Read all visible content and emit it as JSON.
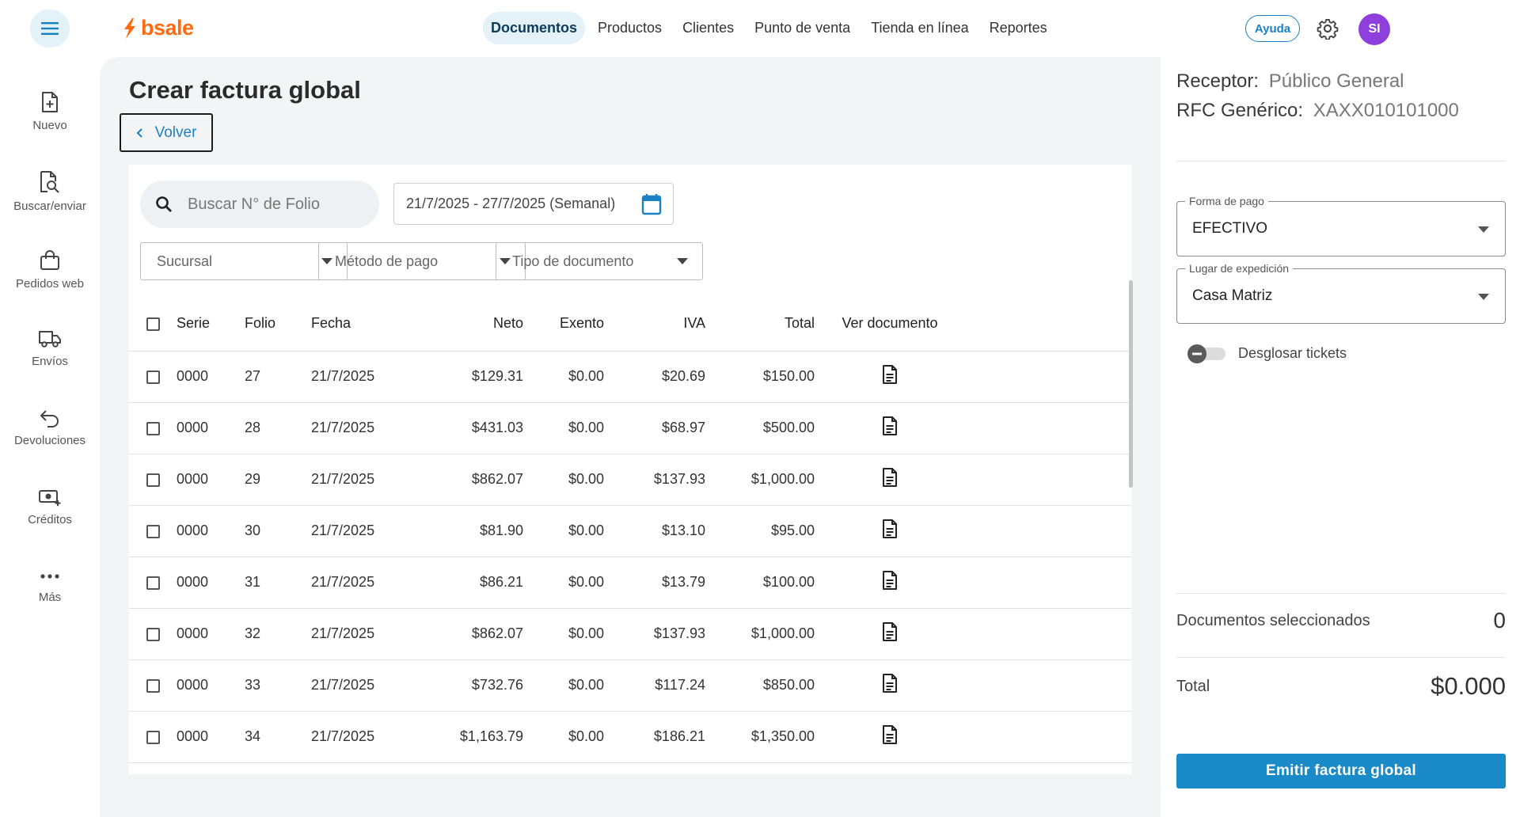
{
  "header": {
    "brand": "bsale",
    "nav": [
      {
        "label": "Documentos",
        "active": true
      },
      {
        "label": "Productos",
        "active": false
      },
      {
        "label": "Clientes",
        "active": false
      },
      {
        "label": "Punto de venta",
        "active": false
      },
      {
        "label": "Tienda en línea",
        "active": false
      },
      {
        "label": "Reportes",
        "active": false
      }
    ],
    "help_label": "Ayuda",
    "avatar_initials": "SI",
    "accent_color": "#1a82c4",
    "brand_color": "#ff6a13",
    "avatar_color": "#8e3fdc"
  },
  "sidebar": {
    "items": [
      {
        "label": "Nuevo",
        "icon": "file-plus-icon"
      },
      {
        "label": "Buscar/enviar",
        "icon": "file-search-icon"
      },
      {
        "label": "Pedidos web",
        "icon": "shopping-bag-icon"
      },
      {
        "label": "Envíos",
        "icon": "truck-icon"
      },
      {
        "label": "Devoluciones",
        "icon": "return-arrow-icon"
      },
      {
        "label": "Créditos",
        "icon": "cash-plus-icon"
      },
      {
        "label": "Más",
        "icon": "more-dots-icon"
      }
    ]
  },
  "main": {
    "title": "Crear factura global",
    "back_label": "Volver",
    "search_placeholder": "Buscar N° de Folio",
    "date_range": "21/7/2025 - 27/7/2025 (Semanal)",
    "filters": {
      "sucursal": "Sucursal",
      "metodo_pago": "Método de pago",
      "tipo_documento": "Tipo de documento"
    },
    "table": {
      "headers": {
        "serie": "Serie",
        "folio": "Folio",
        "fecha": "Fecha",
        "neto": "Neto",
        "exento": "Exento",
        "iva": "IVA",
        "total": "Total",
        "ver": "Ver documento"
      },
      "rows": [
        {
          "serie": "0000",
          "folio": "27",
          "fecha": "21/7/2025",
          "neto": "$129.31",
          "exento": "$0.00",
          "iva": "$20.69",
          "total": "$150.00"
        },
        {
          "serie": "0000",
          "folio": "28",
          "fecha": "21/7/2025",
          "neto": "$431.03",
          "exento": "$0.00",
          "iva": "$68.97",
          "total": "$500.00"
        },
        {
          "serie": "0000",
          "folio": "29",
          "fecha": "21/7/2025",
          "neto": "$862.07",
          "exento": "$0.00",
          "iva": "$137.93",
          "total": "$1,000.00"
        },
        {
          "serie": "0000",
          "folio": "30",
          "fecha": "21/7/2025",
          "neto": "$81.90",
          "exento": "$0.00",
          "iva": "$13.10",
          "total": "$95.00"
        },
        {
          "serie": "0000",
          "folio": "31",
          "fecha": "21/7/2025",
          "neto": "$86.21",
          "exento": "$0.00",
          "iva": "$13.79",
          "total": "$100.00"
        },
        {
          "serie": "0000",
          "folio": "32",
          "fecha": "21/7/2025",
          "neto": "$862.07",
          "exento": "$0.00",
          "iva": "$137.93",
          "total": "$1,000.00"
        },
        {
          "serie": "0000",
          "folio": "33",
          "fecha": "21/7/2025",
          "neto": "$732.76",
          "exento": "$0.00",
          "iva": "$117.24",
          "total": "$850.00"
        },
        {
          "serie": "0000",
          "folio": "34",
          "fecha": "21/7/2025",
          "neto": "$1,163.79",
          "exento": "$0.00",
          "iva": "$186.21",
          "total": "$1,350.00"
        }
      ]
    }
  },
  "panel": {
    "receptor_label": "Receptor:",
    "receptor_value": "Público General",
    "rfc_label": "RFC Genérico:",
    "rfc_value": "XAXX010101000",
    "forma_pago_label": "Forma de pago",
    "forma_pago_value": "EFECTIVO",
    "lugar_label": "Lugar de expedición",
    "lugar_value": "Casa Matriz",
    "toggle_label": "Desglosar tickets",
    "docs_label": "Documentos seleccionados",
    "docs_count": "0",
    "total_label": "Total",
    "total_value": "$0.000",
    "emit_label": "Emitir factura global",
    "button_color": "#1a8ac9"
  }
}
